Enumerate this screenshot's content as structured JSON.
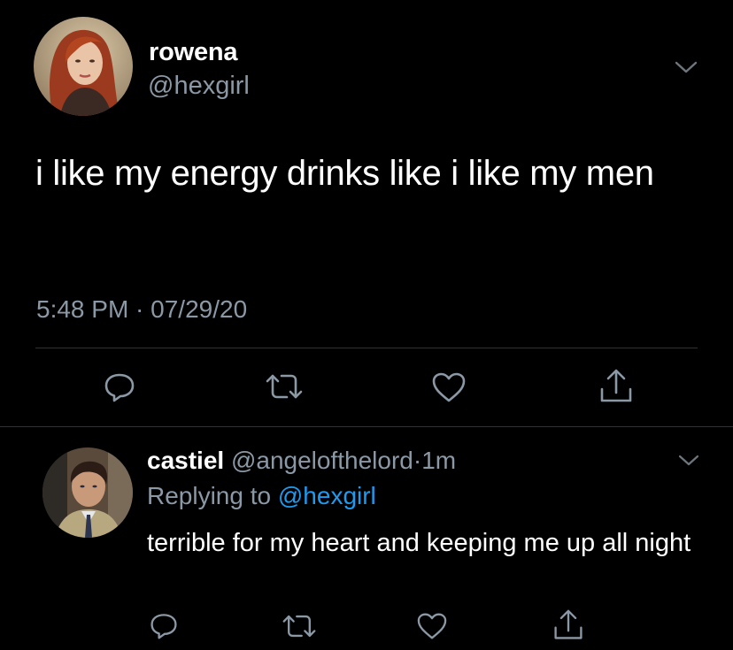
{
  "main_tweet": {
    "display_name": "rowena",
    "handle": "@hexgirl",
    "text": "i like my energy drinks like i like my men",
    "timestamp": "5:48 PM · 07/29/20",
    "actions": [
      "reply-icon",
      "retweet-icon",
      "like-icon",
      "share-icon"
    ]
  },
  "reply": {
    "display_name": "castiel",
    "handle": "@angelofthelord",
    "separator": "·",
    "time_ago": "1m",
    "replying_prefix": "Replying to",
    "replying_mention": "@hexgirl",
    "text": "terrible for my heart and keeping me up all night",
    "actions": [
      "reply-icon",
      "retweet-icon",
      "like-icon",
      "share-icon"
    ]
  },
  "colors": {
    "background": "#000000",
    "text_primary": "#ffffff",
    "text_secondary": "#8b98a5",
    "link": "#1d9bf0",
    "divider": "#2f3336"
  }
}
